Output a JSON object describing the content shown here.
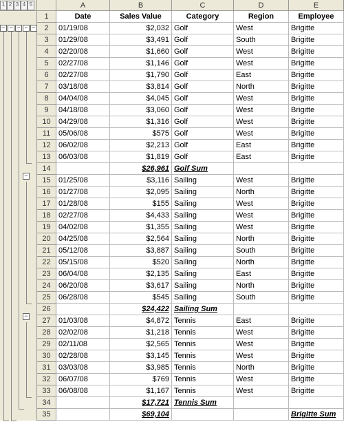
{
  "outline_levels": [
    "1",
    "2",
    "3",
    "4",
    "5"
  ],
  "col_headers": [
    "A",
    "B",
    "C",
    "D",
    "E"
  ],
  "headers": {
    "date": "Date",
    "sales": "Sales Value",
    "category": "Category",
    "region": "Region",
    "employee": "Employee"
  },
  "rows": [
    {
      "n": 1,
      "type": "head"
    },
    {
      "n": 2,
      "date": "01/19/08",
      "sales": "$2,032",
      "category": "Golf",
      "region": "West",
      "employee": "Brigitte"
    },
    {
      "n": 3,
      "date": "01/29/08",
      "sales": "$3,491",
      "category": "Golf",
      "region": "South",
      "employee": "Brigitte"
    },
    {
      "n": 4,
      "date": "02/20/08",
      "sales": "$1,660",
      "category": "Golf",
      "region": "West",
      "employee": "Brigitte"
    },
    {
      "n": 5,
      "date": "02/27/08",
      "sales": "$1,146",
      "category": "Golf",
      "region": "West",
      "employee": "Brigitte"
    },
    {
      "n": 6,
      "date": "02/27/08",
      "sales": "$1,790",
      "category": "Golf",
      "region": "East",
      "employee": "Brigitte"
    },
    {
      "n": 7,
      "date": "03/18/08",
      "sales": "$3,814",
      "category": "Golf",
      "region": "North",
      "employee": "Brigitte"
    },
    {
      "n": 8,
      "date": "04/04/08",
      "sales": "$4,045",
      "category": "Golf",
      "region": "West",
      "employee": "Brigitte"
    },
    {
      "n": 9,
      "date": "04/18/08",
      "sales": "$3,060",
      "category": "Golf",
      "region": "West",
      "employee": "Brigitte"
    },
    {
      "n": 10,
      "date": "04/29/08",
      "sales": "$1,316",
      "category": "Golf",
      "region": "West",
      "employee": "Brigitte"
    },
    {
      "n": 11,
      "date": "05/06/08",
      "sales": "$575",
      "category": "Golf",
      "region": "West",
      "employee": "Brigitte"
    },
    {
      "n": 12,
      "date": "06/02/08",
      "sales": "$2,213",
      "category": "Golf",
      "region": "East",
      "employee": "Brigitte"
    },
    {
      "n": 13,
      "date": "06/03/08",
      "sales": "$1,819",
      "category": "Golf",
      "region": "East",
      "employee": "Brigitte"
    },
    {
      "n": 14,
      "type": "sum",
      "sales": "$26,961",
      "category": "Golf Sum"
    },
    {
      "n": 15,
      "date": "01/25/08",
      "sales": "$3,116",
      "category": "Sailing",
      "region": "West",
      "employee": "Brigitte"
    },
    {
      "n": 16,
      "date": "01/27/08",
      "sales": "$2,095",
      "category": "Sailing",
      "region": "North",
      "employee": "Brigitte"
    },
    {
      "n": 17,
      "date": "01/28/08",
      "sales": "$155",
      "category": "Sailing",
      "region": "West",
      "employee": "Brigitte"
    },
    {
      "n": 18,
      "date": "02/27/08",
      "sales": "$4,433",
      "category": "Sailing",
      "region": "West",
      "employee": "Brigitte"
    },
    {
      "n": 19,
      "date": "04/02/08",
      "sales": "$1,355",
      "category": "Sailing",
      "region": "West",
      "employee": "Brigitte"
    },
    {
      "n": 20,
      "date": "04/25/08",
      "sales": "$2,564",
      "category": "Sailing",
      "region": "North",
      "employee": "Brigitte"
    },
    {
      "n": 21,
      "date": "05/12/08",
      "sales": "$3,887",
      "category": "Sailing",
      "region": "South",
      "employee": "Brigitte"
    },
    {
      "n": 22,
      "date": "05/15/08",
      "sales": "$520",
      "category": "Sailing",
      "region": "North",
      "employee": "Brigitte"
    },
    {
      "n": 23,
      "date": "06/04/08",
      "sales": "$2,135",
      "category": "Sailing",
      "region": "East",
      "employee": "Brigitte"
    },
    {
      "n": 24,
      "date": "06/20/08",
      "sales": "$3,617",
      "category": "Sailing",
      "region": "North",
      "employee": "Brigitte"
    },
    {
      "n": 25,
      "date": "06/28/08",
      "sales": "$545",
      "category": "Sailing",
      "region": "South",
      "employee": "Brigitte"
    },
    {
      "n": 26,
      "type": "sum",
      "sales": "$24,422",
      "category": "Sailing Sum"
    },
    {
      "n": 27,
      "date": "01/03/08",
      "sales": "$4,872",
      "category": "Tennis",
      "region": "East",
      "employee": "Brigitte"
    },
    {
      "n": 28,
      "date": "02/02/08",
      "sales": "$1,218",
      "category": "Tennis",
      "region": "West",
      "employee": "Brigitte"
    },
    {
      "n": 29,
      "date": "02/11/08",
      "sales": "$2,565",
      "category": "Tennis",
      "region": "West",
      "employee": "Brigitte"
    },
    {
      "n": 30,
      "date": "02/28/08",
      "sales": "$3,145",
      "category": "Tennis",
      "region": "West",
      "employee": "Brigitte"
    },
    {
      "n": 31,
      "date": "03/03/08",
      "sales": "$3,985",
      "category": "Tennis",
      "region": "North",
      "employee": "Brigitte"
    },
    {
      "n": 32,
      "date": "06/07/08",
      "sales": "$769",
      "category": "Tennis",
      "region": "West",
      "employee": "Brigitte"
    },
    {
      "n": 33,
      "date": "06/08/08",
      "sales": "$1,167",
      "category": "Tennis",
      "region": "West",
      "employee": "Brigitte"
    },
    {
      "n": 34,
      "type": "sum",
      "sales": "$17,721",
      "category": "Tennis Sum"
    },
    {
      "n": 35,
      "type": "grand",
      "sales": "$69,104",
      "employee": "Brigitte Sum"
    }
  ]
}
